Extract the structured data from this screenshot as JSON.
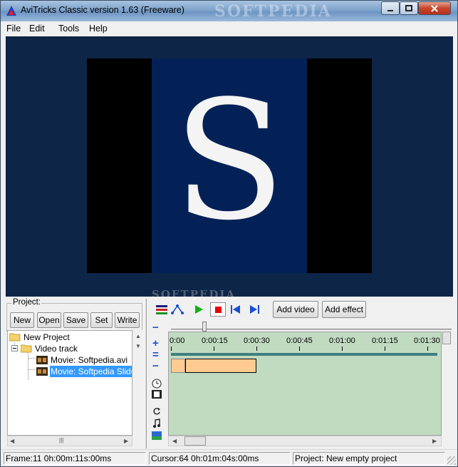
{
  "window": {
    "title": "AviTricks Classic version 1.63 (Freeware)",
    "watermark": "SOFTPEDIA"
  },
  "menu": {
    "items": [
      "File",
      "Edit",
      "Tools",
      "Help"
    ]
  },
  "preview": {
    "letter": "S",
    "watermark": "SOFTPEDIA"
  },
  "project": {
    "group_label": "Project:",
    "buttons": [
      "New",
      "Open",
      "Save",
      "Set",
      "Write"
    ],
    "tree": {
      "root": "New Project",
      "track": "Video track",
      "items": [
        "Movie: Softpedia.avi",
        "Movie: Softpedia Slides"
      ]
    }
  },
  "timeline": {
    "add_video_label": "Add video",
    "add_effect_label": "Add effect",
    "zoom_plus": "+",
    "zoom_equal": "=",
    "zoom_minus": "−",
    "zoom_top": "−",
    "ruler": [
      "0:00",
      "0:00:15",
      "0:00:30",
      "0:00:45",
      "0:01:00",
      "0:01:15",
      "0:01:30"
    ]
  },
  "status": {
    "frame": "Frame:11   0h:00m:11s:00ms",
    "cursor": "Cursor:64   0h:01m:04s:00ms",
    "project": "Project: New empty project"
  },
  "colors": {
    "timeline_bg": "#c1dbc1",
    "clip_fill": "#ffcb91",
    "ruler_bar": "#3f7f7f",
    "selection": "#3399ff",
    "preview_bg": "#0d2546"
  }
}
